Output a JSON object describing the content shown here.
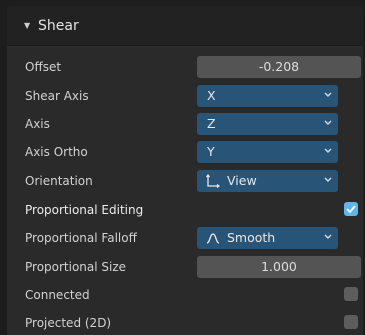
{
  "panel": {
    "title": "Shear",
    "offset": {
      "label": "Offset",
      "value": "-0.208"
    },
    "shear_axis": {
      "label": "Shear Axis",
      "value": "X"
    },
    "axis": {
      "label": "Axis",
      "value": "Z"
    },
    "axis_ortho": {
      "label": "Axis Ortho",
      "value": "Y"
    },
    "orientation": {
      "label": "Orientation",
      "value": "View",
      "icon": "orientation-view-icon"
    },
    "proportional_editing": {
      "label": "Proportional Editing",
      "checked": true
    },
    "proportional_falloff": {
      "label": "Proportional Falloff",
      "value": "Smooth",
      "icon": "smooth-falloff-icon"
    },
    "proportional_size": {
      "label": "Proportional Size",
      "value": "1.000"
    },
    "connected": {
      "label": "Connected",
      "checked": false
    },
    "projected": {
      "label": "Projected (2D)",
      "checked": false
    }
  },
  "colors": {
    "dropdown_bg": "#285577",
    "numfield_bg": "#545454",
    "checkbox_on": "#5fb7e9",
    "checkbox_off": "#5d5d5d",
    "panel_bg": "#2a2a2a"
  }
}
